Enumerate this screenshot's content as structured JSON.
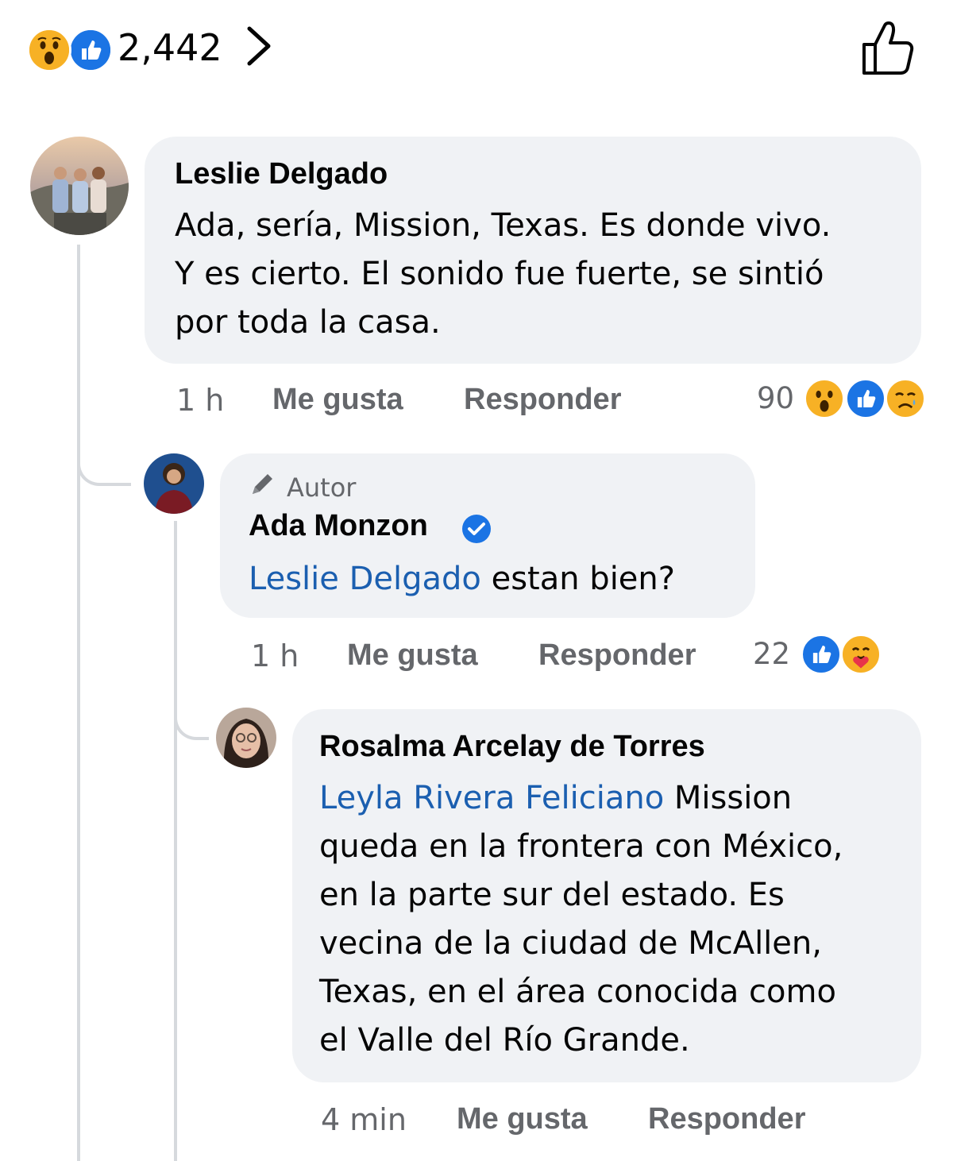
{
  "post_reactions": {
    "count": "2,442",
    "icons": [
      "wow-icon",
      "like-icon"
    ]
  },
  "comments": [
    {
      "author": "Leslie Delgado",
      "text_lines": [
        "Ada, sería, Mission, Texas. Es donde vivo.",
        "Y es cierto. El sonido fue fuerte, se sintió",
        "por toda la casa."
      ],
      "time": "1 h",
      "like_label": "Me gusta",
      "reply_label": "Responder",
      "reaction_count": "90",
      "reaction_icons": [
        "wow-icon",
        "like-icon",
        "sad-icon"
      ]
    },
    {
      "badge": "Autor",
      "author": "Ada Monzon",
      "verified": true,
      "mention": "Leslie Delgado",
      "text": " estan bien?",
      "time": "1 h",
      "like_label": "Me gusta",
      "reply_label": "Responder",
      "reaction_count": "22",
      "reaction_icons": [
        "like-icon",
        "care-icon"
      ]
    },
    {
      "author": "Rosalma Arcelay de Torres",
      "mention": "Leyla Rivera Feliciano",
      "first_line_rest": " Mission",
      "text_lines": [
        "queda en la frontera con México,",
        "en la parte sur del estado. Es",
        "vecina de la ciudad de McAllen,",
        "Texas, en el área conocida como",
        "el Valle del Río Grande."
      ],
      "time": "4 min",
      "like_label": "Me gusta",
      "reply_label": "Responder"
    }
  ],
  "colors": {
    "bubble": "#f0f2f5",
    "mention": "#1b5fb0",
    "meta": "#65676b",
    "like_blue": "#1b74e4",
    "wow_yellow": "#f7b125"
  }
}
